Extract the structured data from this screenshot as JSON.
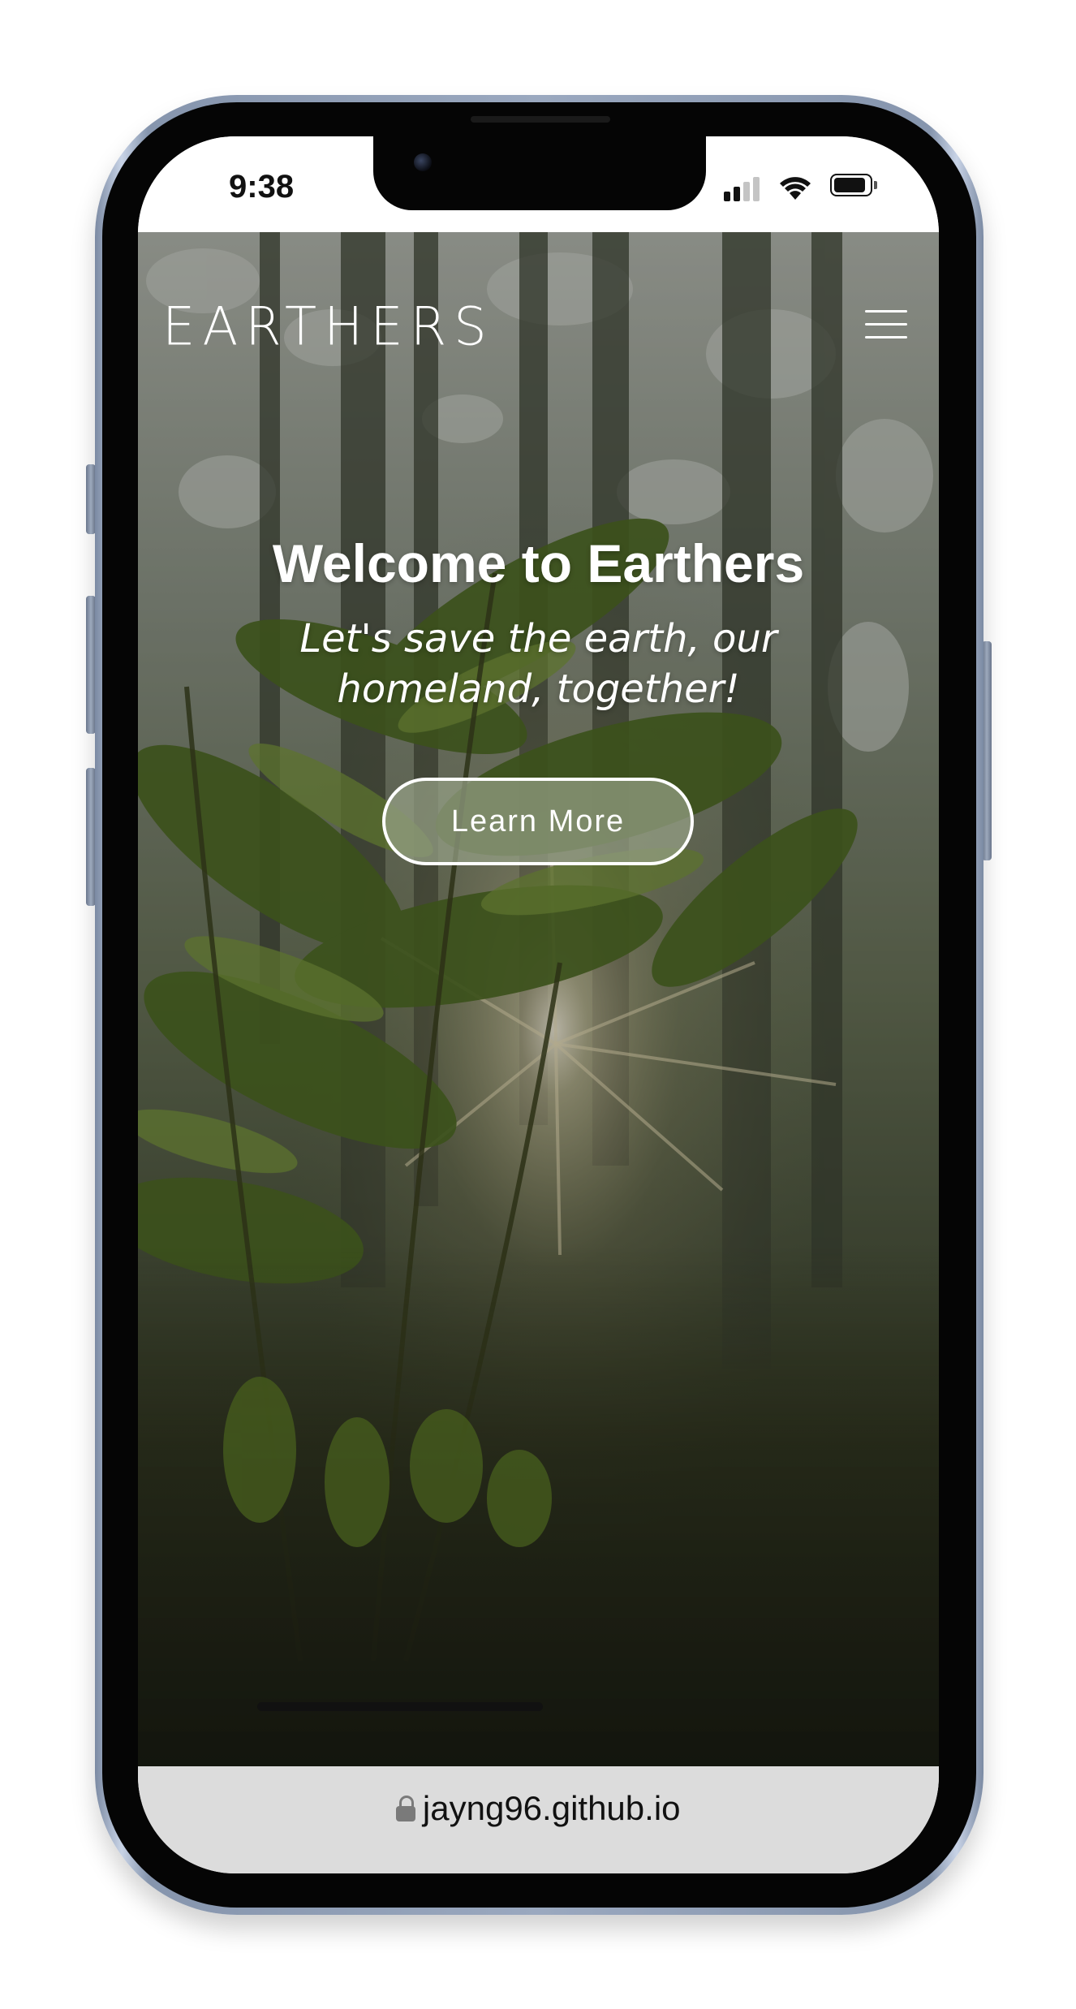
{
  "status_bar": {
    "time": "9:38",
    "icons": [
      "signal-icon",
      "wifi-icon",
      "battery-icon"
    ],
    "signal_bars_filled": 2,
    "signal_bars_total": 4,
    "battery_level": 0.9
  },
  "site": {
    "logo": "EARTHERS",
    "menu_icon": "hamburger-menu-icon"
  },
  "hero": {
    "title": "Welcome to Earthers",
    "subtitle": "Let's save the earth, our homeland, together!",
    "cta_label": "Learn More"
  },
  "browser": {
    "url": "jayng96.github.io",
    "lock_icon": "lock-icon"
  },
  "colors": {
    "phone_frame": "#9aa8bf",
    "address_bar": "#dcdcdc",
    "hero_text": "#ffffff",
    "button_fill": "#96a087"
  }
}
